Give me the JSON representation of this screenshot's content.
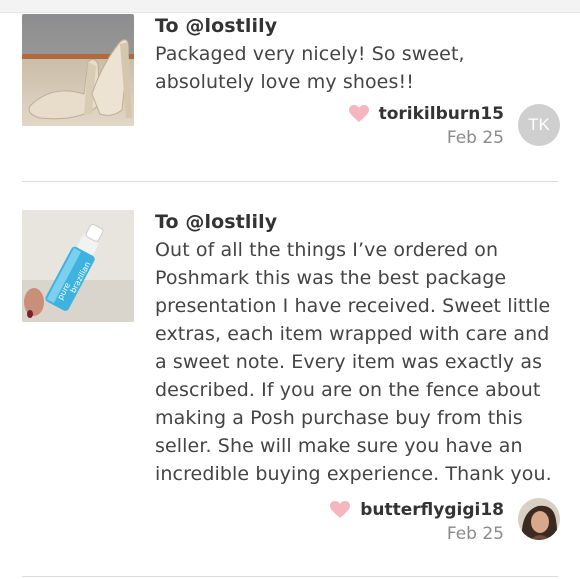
{
  "reviews": [
    {
      "to": "To @lostlily",
      "body": "Packaged very nicely! So sweet, absolutely love my shoes!!",
      "username": "torikilburn15",
      "date": "Feb 25",
      "avatar_initials": "TK",
      "thumb_icon": "heels-photo",
      "heart_color": "#f6b6bf"
    },
    {
      "to": "To @lostlily",
      "body": "Out of all the things I’ve ordered on Poshmark this was the best package presentation I have received. Sweet little extras, each item wrapped with care and a sweet note. Every item was exactly as described. If you are on the fence about making a Posh purchase buy from this seller. She will make sure you have an incredible buying experience. Thank you.",
      "username": "butterflygigi18",
      "date": "Feb 25",
      "thumb_icon": "spray-bottle-photo",
      "heart_color": "#f6b6bf"
    }
  ],
  "thumb_text": [
    "pure",
    "brazilian"
  ]
}
